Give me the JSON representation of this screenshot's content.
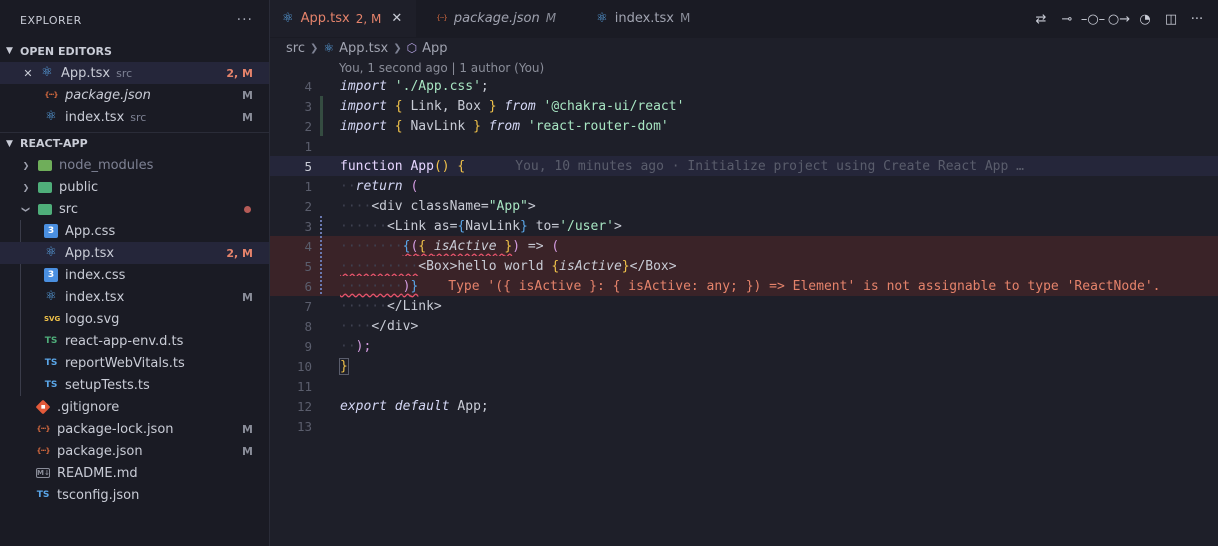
{
  "sidebar": {
    "title": "EXPLORER",
    "more": "···",
    "open_editors_title": "OPEN EDITORS",
    "open_editors": [
      {
        "name": "App.tsx",
        "desc": "src",
        "status": "2, M",
        "icon": "react-icon",
        "active": true,
        "italic": false
      },
      {
        "name": "package.json",
        "desc": "",
        "status": "M",
        "icon": "json-icon",
        "active": false,
        "italic": true
      },
      {
        "name": "index.tsx",
        "desc": "src",
        "status": "M",
        "icon": "react-icon",
        "active": false,
        "italic": false
      }
    ],
    "project_title": "REACT-APP",
    "tree": [
      {
        "name": "node_modules",
        "icon": "folder-icon"
      },
      {
        "name": "public",
        "icon": "folder-icon"
      },
      {
        "name": "src",
        "icon": "folder-icon"
      },
      {
        "name": "App.css",
        "icon": "css-icon"
      },
      {
        "name": "App.tsx",
        "icon": "react-icon",
        "status": "2, M"
      },
      {
        "name": "index.css",
        "icon": "css-icon"
      },
      {
        "name": "index.tsx",
        "icon": "react-icon",
        "status": "M"
      },
      {
        "name": "logo.svg",
        "icon": "svg-icon"
      },
      {
        "name": "react-app-env.d.ts",
        "icon": "ts-icon"
      },
      {
        "name": "reportWebVitals.ts",
        "icon": "ts-icon"
      },
      {
        "name": "setupTests.ts",
        "icon": "ts-icon"
      },
      {
        "name": ".gitignore",
        "icon": "git-icon"
      },
      {
        "name": "package-lock.json",
        "icon": "json-icon",
        "status": "M"
      },
      {
        "name": "package.json",
        "icon": "json-icon",
        "status": "M"
      },
      {
        "name": "README.md",
        "icon": "md-icon"
      },
      {
        "name": "tsconfig.json",
        "icon": "ts-icon"
      }
    ]
  },
  "tabs": [
    {
      "label": "App.tsx",
      "status": "2, M"
    },
    {
      "label": "package.json",
      "status": "M"
    },
    {
      "label": "index.tsx",
      "status": "M"
    }
  ],
  "breadcrumb": [
    "src",
    "App.tsx",
    "App"
  ],
  "codelens": "You, 1 second ago | 1 author (You)",
  "line_numbers": [
    "4",
    "3",
    "2",
    "1",
    "5",
    "1",
    "2",
    "3",
    "4",
    "5",
    "6",
    "7",
    "8",
    "9",
    "10",
    "11",
    "12",
    "13"
  ],
  "blame": "You, 10 minutes ago · Initialize project using Create React App …",
  "error_message": "Type '({ isActive }: { isActive: any; }) => Element' is not assignable to type 'ReactNode'.",
  "code": {
    "l1_kw": "import",
    "l1_str": "'./App.css'",
    "l1_end": ";",
    "l2_kw": "import",
    "l2_mid": " Link, Box ",
    "l2_from": "from",
    "l2_str": "'@chakra-ui/react'",
    "l3_kw": "import",
    "l3_mid": " NavLink ",
    "l3_from": "from",
    "l3_str": "'react-router-dom'",
    "l5_fn": "function",
    "l5_name": "App",
    "l6_kw": "return",
    "l6_rest": " (",
    "l7_tag": "<div",
    "l7_attr": " className=",
    "l7_val": "\"App\"",
    "l7_end": ">",
    "l8_tag": "<Link",
    "l8_attr1": " as=",
    "l8_val1": "NavLink",
    "l8_attr2": " to=",
    "l8_val2": "'/user'",
    "l8_end": ">",
    "l9_param": "isActive",
    "l9_arrow": " => ",
    "l10_open": "<Box>",
    "l10_text": "hello world ",
    "l10_var": "isActive",
    "l10_close": "</Box>",
    "l12_close": "</Link>",
    "l13_close": "</div>",
    "l14_close": ");",
    "l17_kw1": "export",
    "l17_kw2": "default",
    "l17_name": "App",
    "l17_end": ";"
  }
}
